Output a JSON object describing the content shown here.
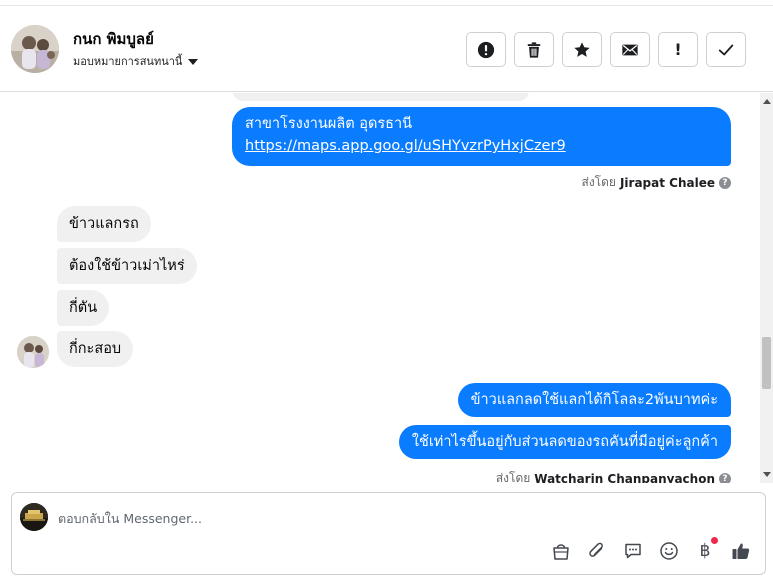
{
  "header": {
    "contact_name": "กนก พิมบูลย์",
    "assign_label": "มอบหมายการสนทนานี้",
    "actions": [
      {
        "name": "report-spam-button",
        "icon": "alert-circle-icon"
      },
      {
        "name": "delete-button",
        "icon": "trash-icon"
      },
      {
        "name": "star-button",
        "icon": "star-icon"
      },
      {
        "name": "mark-unread-button",
        "icon": "envelope-icon"
      },
      {
        "name": "follow-up-button",
        "icon": "exclamation-icon",
        "label": "!"
      },
      {
        "name": "mark-done-button",
        "icon": "checkmark-icon"
      }
    ]
  },
  "messages": {
    "out1": {
      "line1": "สาขาโรงงานผลิต อุดรธานี",
      "link": "https://maps.app.goo.gl/uSHYvzrPyHxjCzer9"
    },
    "sent_by_1": {
      "prefix": "ส่งโดย",
      "name": "Jirapat Chalee"
    },
    "in": [
      "ข้าวแลกรถ",
      "ต้องใช้ข้าวเม่าไหร่",
      "กี่ตัน",
      "กี่กะสอบ"
    ],
    "out2": [
      "ข้าวแลกลดใช้แลกได้กิโลละ2พันบาทค่ะ",
      "ใช้เท่าไรขึ้นอยู่กับส่วนลดของรถคันที่มีอยู่ค่ะลูกค้า"
    ],
    "sent_by_2": {
      "prefix": "ส่งโดย",
      "name": "Watcharin Chanpanyachon"
    }
  },
  "composer": {
    "placeholder": "ตอบกลับใน Messenger...",
    "tools": [
      {
        "name": "shop-bag-icon"
      },
      {
        "name": "paperclip-icon"
      },
      {
        "name": "saved-replies-icon"
      },
      {
        "name": "emoji-icon"
      },
      {
        "name": "payment-baht-icon",
        "label": "฿"
      },
      {
        "name": "thumbs-up-icon"
      }
    ]
  },
  "colors": {
    "outgoing_bubble": "#0a7cff",
    "incoming_bubble": "#f0f0f0",
    "notification_dot": "#f02849"
  }
}
